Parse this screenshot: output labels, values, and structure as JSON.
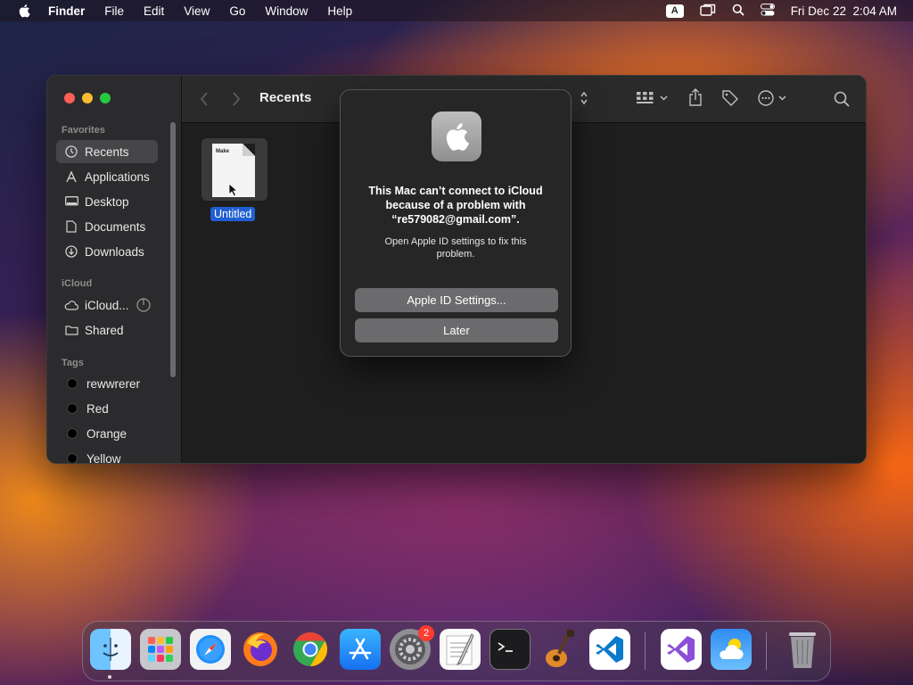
{
  "menubar": {
    "app_name": "Finder",
    "items": [
      "File",
      "Edit",
      "View",
      "Go",
      "Window",
      "Help"
    ],
    "input_source": "A",
    "datetime": "Fri Dec 22  2:04 AM"
  },
  "finder": {
    "title": "Recents",
    "sidebar": {
      "favorites_header": "Favorites",
      "favorites": [
        {
          "label": "Recents",
          "icon": "clock-icon",
          "active": true
        },
        {
          "label": "Applications",
          "icon": "applications-icon"
        },
        {
          "label": "Desktop",
          "icon": "desktop-icon"
        },
        {
          "label": "Documents",
          "icon": "document-icon"
        },
        {
          "label": "Downloads",
          "icon": "download-icon"
        }
      ],
      "icloud_header": "iCloud",
      "icloud": [
        {
          "label": "iCloud...",
          "icon": "cloud-icon"
        },
        {
          "label": "Shared",
          "icon": "shared-folder-icon"
        }
      ],
      "tags_header": "Tags",
      "tags": [
        "rewwrerer",
        "Red",
        "Orange",
        "Yellow"
      ]
    },
    "file": {
      "name": "Untitled",
      "preview_text": "Make"
    }
  },
  "dialog": {
    "title": "This Mac can’t connect to iCloud because of a problem with “re579082@gmail.com”.",
    "message": "Open Apple ID settings to fix this problem.",
    "primary_button": "Apple ID Settings...",
    "secondary_button": "Later"
  },
  "dock": {
    "apps": [
      "Finder",
      "Launchpad",
      "Safari",
      "Firefox",
      "Chrome",
      "App Store",
      "System Settings",
      "TextEdit",
      "Terminal",
      "GarageBand",
      "Visual Studio Code",
      "Visual Studio",
      "Weather",
      "Trash"
    ],
    "settings_badge": "2"
  }
}
